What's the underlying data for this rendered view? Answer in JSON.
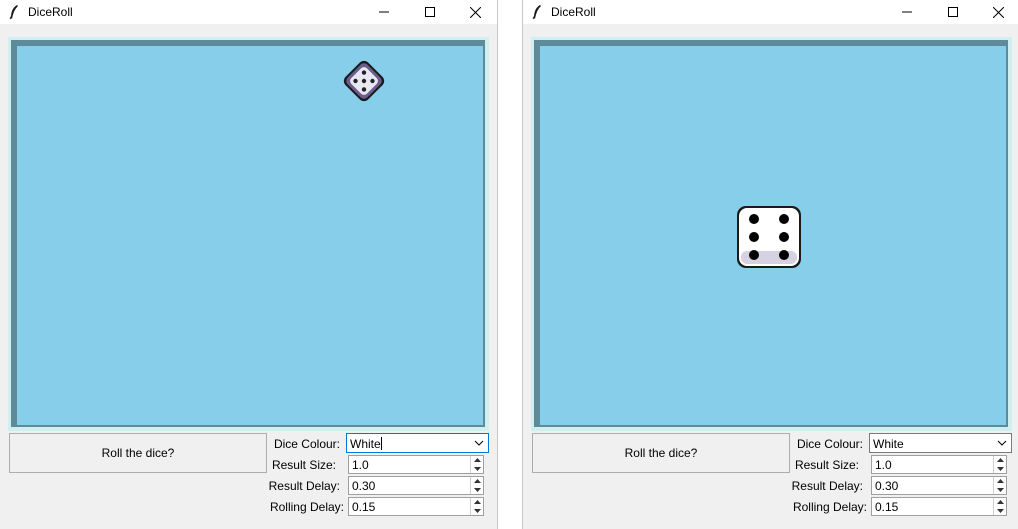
{
  "windows": [
    {
      "title": "DiceRoll",
      "roll_button": "Roll the dice?",
      "labels": {
        "dice_colour": "Dice Colour:",
        "result_size": "Result Size:",
        "result_delay": "Result Delay:",
        "rolling_delay": "Rolling Delay:"
      },
      "dice_colour": "White",
      "result_size": "1.0",
      "result_delay": "0.30",
      "rolling_delay": "0.15",
      "die": {
        "face": 5,
        "state": "rolling",
        "color": "#6a5f8c"
      }
    },
    {
      "title": "DiceRoll",
      "roll_button": "Roll the dice?",
      "labels": {
        "dice_colour": "Dice Colour:",
        "result_size": "Result Size:",
        "result_delay": "Result Delay:",
        "rolling_delay": "Rolling Delay:"
      },
      "dice_colour": "White",
      "result_size": "1.0",
      "result_delay": "0.30",
      "rolling_delay": "0.15",
      "die": {
        "face": 6,
        "state": "result",
        "color": "#ffffff"
      }
    }
  ],
  "colors": {
    "canvas": "#87ceeb",
    "canvas_border": "#5f8a9a",
    "window_bg": "#f0f0f0",
    "focus": "#0078d7"
  },
  "icons": {
    "app": "feather-icon",
    "minimize": "minimize-icon",
    "maximize": "maximize-icon",
    "close": "close-icon"
  }
}
